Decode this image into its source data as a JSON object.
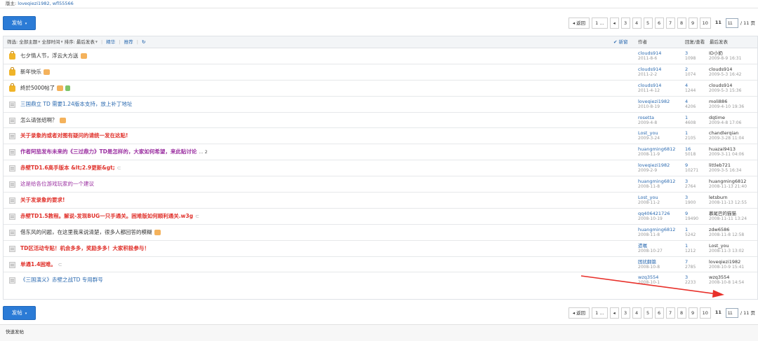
{
  "moderators": {
    "label": "版主:",
    "names": "loveqiezi1982, wfl55566"
  },
  "post_button": {
    "label": "发帖",
    "caret": "▾"
  },
  "pager": {
    "back": "◂ 返回",
    "first": "1 ...",
    "prev": "◂",
    "pages": [
      "3",
      "4",
      "5",
      "6",
      "7",
      "8",
      "9",
      "10"
    ],
    "current": "11",
    "input_value": "11",
    "total": "/ 11 页"
  },
  "filter_bar": {
    "label": "筛选:",
    "all_topics": "全部主题",
    "all_time": "全部时间",
    "sort": "排序: 最后发表",
    "digest": "精华",
    "recommend": "推荐",
    "refresh_icon": "↻",
    "new_window": "✔ 新窗",
    "col_author": "作者",
    "col_replies": "回复/查看",
    "col_last": "最后发表"
  },
  "threads": [
    {
      "icon": "lock-icon",
      "title": "七夕情人节，浮云大方送",
      "style": "c-default",
      "emo": true,
      "author": "clouds914",
      "date": "2011-8-6",
      "replies": "3",
      "views": "1098",
      "last_user": "ID小奶",
      "last_time": "2009-8-9 16:31"
    },
    {
      "icon": "lock-icon",
      "title": "新年快乐",
      "style": "c-default",
      "emo": true,
      "author": "clouds914",
      "date": "2011-2-2",
      "replies": "2",
      "views": "1074",
      "last_user": "clouds914",
      "last_time": "2009-5-3 16:42"
    },
    {
      "icon": "lock-icon",
      "title": "終於5000帖了",
      "style": "c-default",
      "emo": true,
      "emo2": true,
      "author": "clouds914",
      "date": "2011-4-12",
      "replies": "4",
      "views": "1244",
      "last_user": "clouds914",
      "last_time": "2009-5-3 15:36"
    },
    {
      "icon": "doc-icon",
      "title": "三国鼎立 TD 需要1.24版本支持，放上补丁地址",
      "style": "c-blue",
      "author": "loveqiezi1982",
      "date": "2010-8-19",
      "replies": "4",
      "views": "4206",
      "last_user": "moli886",
      "last_time": "2009-4-10 19:36"
    },
    {
      "icon": "doc-icon",
      "title": "怎么请张绍啊？",
      "style": "c-default",
      "emo": true,
      "author": "rosetta",
      "date": "2009-4-8",
      "replies": "1",
      "views": "4608",
      "last_user": "dqtime",
      "last_time": "2009-4-8 17:06"
    },
    {
      "icon": "doc-icon",
      "title": "关于录象的或者对图有疑问的请统一发在这贴!",
      "style": "c-red",
      "author": "Lost_you",
      "date": "2009-3-24",
      "replies": "1",
      "views": "2105",
      "last_user": "chandlerqian",
      "last_time": "2009-3-28 11:04"
    },
    {
      "icon": "doc-icon",
      "title": "作者阿茄发布未来的《三过鼎力》TD是怎样的，大家如何希望，来此贴讨论",
      "style": "c-purple",
      "more": "... 2",
      "author": "huangming6812",
      "date": "2008-11-9",
      "replies": "16",
      "views": "5018",
      "last_user": "huazai9413",
      "last_time": "2009-3-11 04:06"
    },
    {
      "icon": "doc-icon",
      "title": "赤壁TD1.6高手版本 &lt;2.9更新&gt;",
      "style": "c-red",
      "attach": true,
      "author": "loveqiezi1982",
      "date": "2009-2-9",
      "replies": "9",
      "views": "10271",
      "last_user": "littleb721",
      "last_time": "2009-3-5 16:34"
    },
    {
      "icon": "doc-icon",
      "title": "这是给各位游戏玩家的一个建议",
      "style": "c-purple-normal",
      "author": "huangming6812",
      "date": "2008-11-8",
      "replies": "3",
      "views": "2764",
      "last_user": "huangming6812",
      "last_time": "2008-11-13 21:40"
    },
    {
      "icon": "doc-icon",
      "title": "关于发录象的要求!",
      "style": "c-red",
      "author": "Lost_you",
      "date": "2008-11-2",
      "replies": "3",
      "views": "1900",
      "last_user": "letsburn",
      "last_time": "2008-11-13 12:55"
    },
    {
      "icon": "doc-icon",
      "title": "赤壁TD1.5教程。解说-发现BUG一只手通关。困难版如何顺利通关.w3g",
      "style": "c-red",
      "attach": true,
      "author": "qq406421726",
      "date": "2008-10-19",
      "replies": "9",
      "views": "19490",
      "last_user": "慕尾巴的猫猫",
      "last_time": "2008-11-11 13:24"
    },
    {
      "icon": "doc-icon",
      "title": "借东风的问题，在这里我来说清楚，很多人都回答的模糊",
      "style": "c-default",
      "emo": true,
      "author": "huangming6812",
      "date": "2008-11-8",
      "replies": "1",
      "views": "5242",
      "last_user": "zdw6586",
      "last_time": "2008-11-8 12:58"
    },
    {
      "icon": "doc-icon",
      "title": "TD区活动专贴！机会多多，奖励多多！大家积极参与！",
      "style": "c-red",
      "author": "遗嘱",
      "date": "2008-10-27",
      "replies": "1",
      "views": "1212",
      "last_user": "Lost_you",
      "last_time": "2008-11-3 13:02"
    },
    {
      "icon": "doc-icon",
      "title": "单通1.4困难。",
      "style": "c-red",
      "attach": true,
      "author": "困扰翻篇",
      "date": "2008-10-8",
      "replies": "7",
      "views": "2785",
      "last_user": "loveqiezi1982",
      "last_time": "2008-10-9 15:41"
    },
    {
      "icon": "doc-icon",
      "title": "《三国演义》赤壁之战TD 专用群号",
      "style": "c-blue",
      "author": "wzq3554",
      "date": "2008-10-1",
      "replies": "3",
      "views": "2233",
      "last_user": "wzq3554",
      "last_time": "2008-10-8 14:54"
    }
  ],
  "quick_post": {
    "label": "快速发帖"
  },
  "colors": {
    "accent": "#2b7bd6",
    "red": "#e0312b",
    "purple": "#9a2ea0",
    "arrow": "#e8302a"
  }
}
